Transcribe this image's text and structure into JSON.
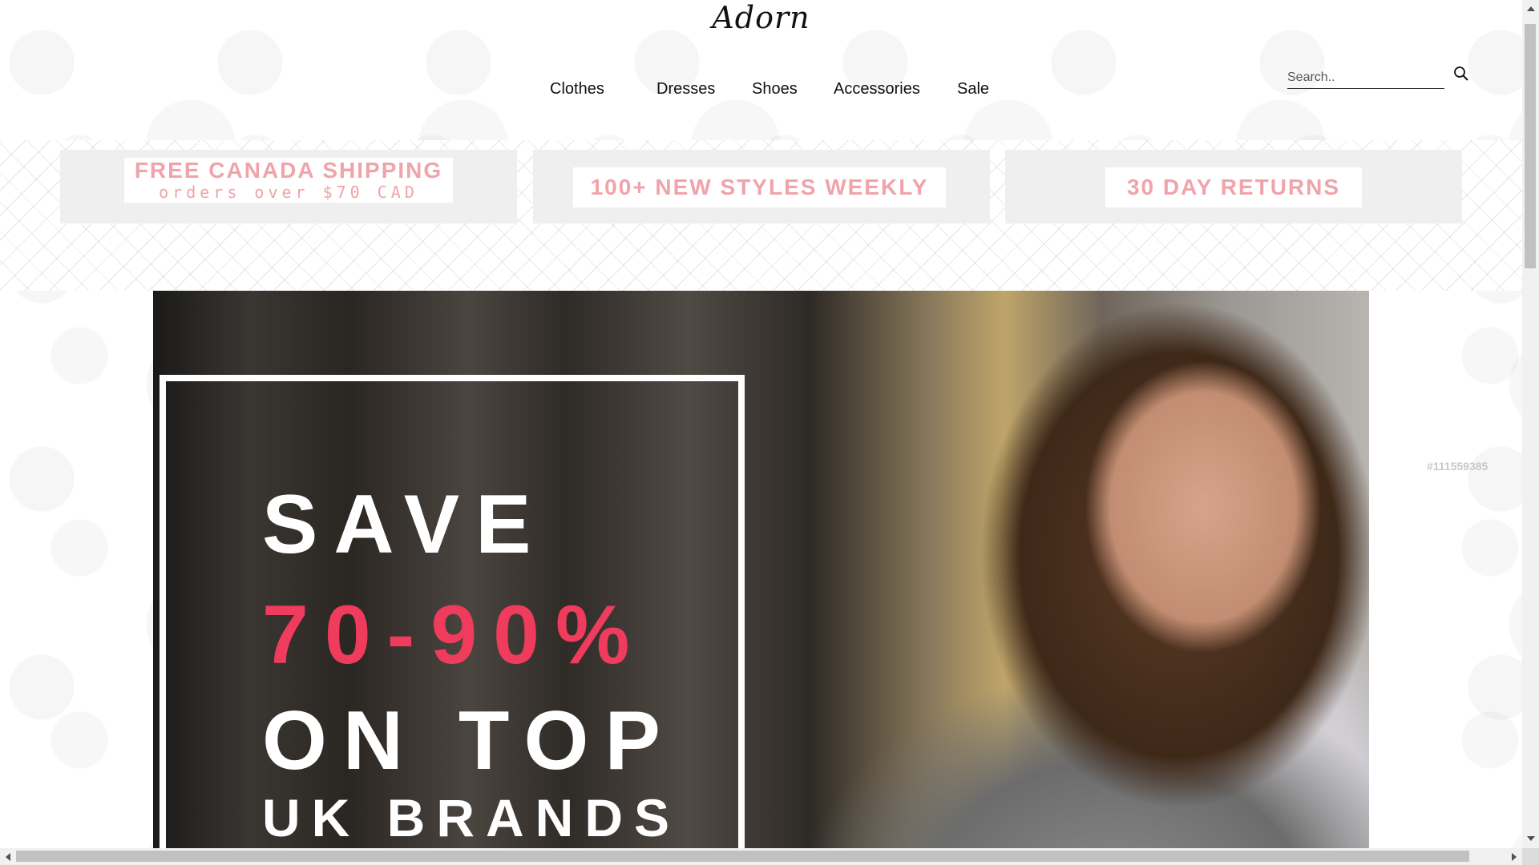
{
  "brand": {
    "logo_text": "Adorn"
  },
  "nav": {
    "items": [
      {
        "label": "Clothes"
      },
      {
        "label": "Dresses"
      },
      {
        "label": "Shoes"
      },
      {
        "label": "Accessories"
      },
      {
        "label": "Sale"
      }
    ]
  },
  "search": {
    "placeholder": "Search..",
    "value": "",
    "icon": "search-icon"
  },
  "promos": [
    {
      "title": "FREE CANADA SHIPPING",
      "subtitle": "orders over $70 CAD"
    },
    {
      "title": "100+ NEW STYLES WEEKLY",
      "subtitle": ""
    },
    {
      "title": "30 DAY RETURNS",
      "subtitle": ""
    }
  ],
  "hero": {
    "line1": "SAVE",
    "line2": "70-90%",
    "line3": "ON TOP",
    "line4": "UK BRANDS"
  },
  "watermark_text": "#111559385",
  "colors": {
    "promo_pink": "#f0a3aa",
    "promo_box": "#efefef",
    "hero_pink": "#ef3b5c"
  }
}
